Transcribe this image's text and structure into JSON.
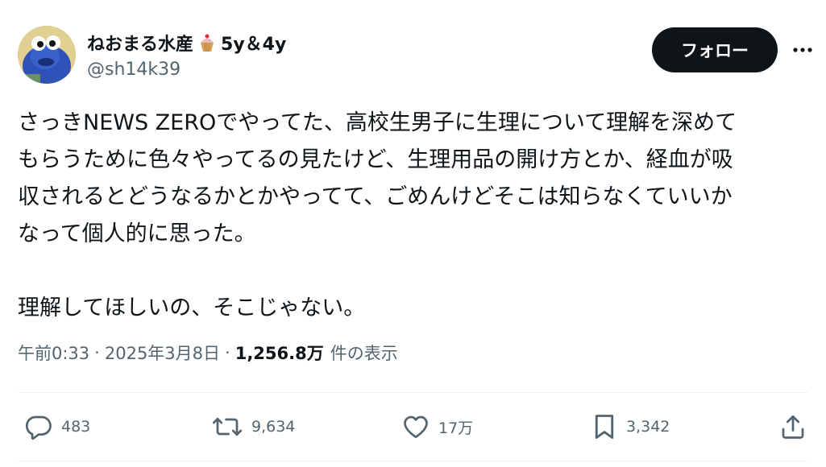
{
  "user": {
    "display_name": "ねおまる水産",
    "name_suffix": "5y＆4y",
    "handle": "@sh14k39",
    "badge_icon": "cupcake-emoji"
  },
  "header": {
    "follow_label": "フォロー",
    "more_icon": "more-dots-icon"
  },
  "tweet": {
    "lines": [
      "さっきNEWS ZEROでやってた、高校生男子に生理について理解を深めて",
      "もらうために色々やってるの見たけど、生理用品の開け方とか、経血が吸",
      "収されるとどうなるかとかやってて、ごめんけどそこは知らなくていいか",
      "なって個人的に思った。",
      "理解してほしいの、そこじゃない。"
    ]
  },
  "meta": {
    "time": "午前0:33",
    "date": "2025年3月8日",
    "views_count": "1,256.8万",
    "views_label": "件の表示"
  },
  "actions": {
    "replies": "483",
    "retweets": "9,634",
    "likes": "17万",
    "bookmarks": "3,342"
  },
  "colors": {
    "primary_text": "#0f1419",
    "secondary_text": "#536471",
    "button_bg": "#0f1419",
    "divider": "#eff3f4"
  }
}
